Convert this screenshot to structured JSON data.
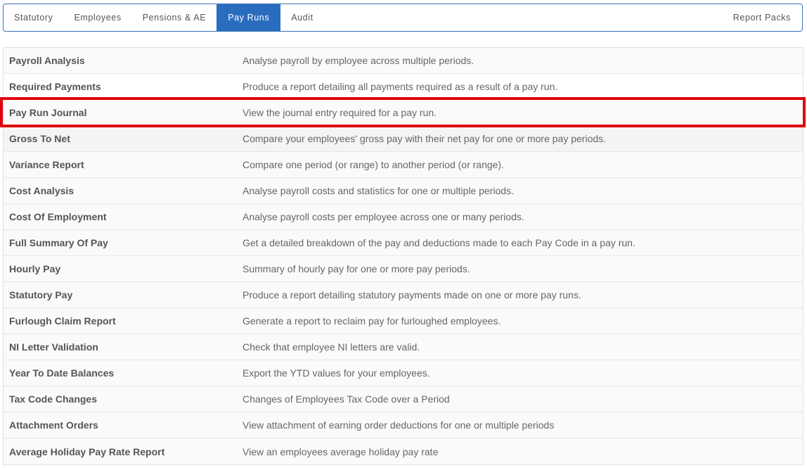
{
  "nav": {
    "tabs": [
      {
        "label": "Statutory"
      },
      {
        "label": "Employees"
      },
      {
        "label": "Pensions & AE"
      },
      {
        "label": "Pay Runs"
      },
      {
        "label": "Audit"
      }
    ],
    "active_tab": "Pay Runs",
    "right_link": "Report Packs"
  },
  "reports": [
    {
      "name": "Payroll Analysis",
      "description": "Analyse payroll by employee across multiple periods."
    },
    {
      "name": "Required Payments",
      "description": "Produce a report detailing all payments required as a result of a pay run."
    },
    {
      "name": "Pay Run Journal",
      "description": "View the journal entry required for a pay run."
    },
    {
      "name": "Gross To Net",
      "description": "Compare your employees' gross pay with their net pay for one or more pay periods."
    },
    {
      "name": "Variance Report",
      "description": "Compare one period (or range) to another period (or range)."
    },
    {
      "name": "Cost Analysis",
      "description": "Analyse payroll costs and statistics for one or multiple periods."
    },
    {
      "name": "Cost Of Employment",
      "description": "Analyse payroll costs per employee across one or many periods."
    },
    {
      "name": "Full Summary Of Pay",
      "description": "Get a detailed breakdown of the pay and deductions made to each Pay Code in a pay run."
    },
    {
      "name": "Hourly Pay",
      "description": "Summary of hourly pay for one or more pay periods."
    },
    {
      "name": "Statutory Pay",
      "description": "Produce a report detailing statutory payments made on one or more pay runs."
    },
    {
      "name": "Furlough Claim Report",
      "description": "Generate a report to reclaim pay for furloughed employees."
    },
    {
      "name": "NI Letter Validation",
      "description": "Check that employee NI letters are valid."
    },
    {
      "name": "Year To Date Balances",
      "description": "Export the YTD values for your employees."
    },
    {
      "name": "Tax Code Changes",
      "description": "Changes of Employees Tax Code over a Period"
    },
    {
      "name": "Attachment Orders",
      "description": "View attachment of earning order deductions for one or multiple periods"
    },
    {
      "name": "Average Holiday Pay Rate Report",
      "description": "View an employees average holiday pay rate"
    }
  ],
  "highlighted_report": "Pay Run Journal",
  "colors": {
    "accent": "#2a6dbf",
    "nav_border": "#3b74b8",
    "highlight_border": "#e0000b"
  }
}
